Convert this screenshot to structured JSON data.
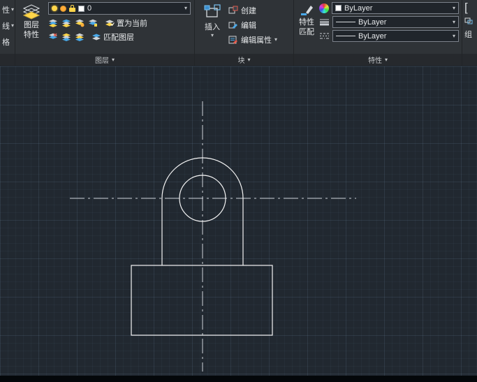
{
  "icons": {
    "dropdown_arrow": "▾",
    "bracket": "["
  },
  "ribbon": {
    "left_partial": {
      "row1": "性",
      "row2": "线",
      "row3": "格"
    },
    "layers": {
      "panel_label": "图层",
      "layer_properties_line1": "图层",
      "layer_properties_line2": "特性",
      "layer_combo_value": "0",
      "set_current": "置为当前",
      "match_layer": "匹配图层"
    },
    "block": {
      "panel_label": "块",
      "insert": "插入",
      "create": "创建",
      "edit": "编辑",
      "edit_attributes": "编辑属性"
    },
    "properties": {
      "panel_label": "特性",
      "match_line1": "特性",
      "match_line2": "匹配",
      "color_value": "ByLayer",
      "lineweight_value": "ByLayer",
      "linetype_value": "ByLayer"
    },
    "right_partial": {
      "panel_label_partial": "组"
    }
  },
  "colors": {
    "accent_blue": "#49a8e8",
    "accent_yellow": "#ffd54a",
    "ribbon_background": "#2f3337",
    "canvas_background": "#212830",
    "drawing_line": "#f4f4f4",
    "centerline": "#cfd4da"
  }
}
